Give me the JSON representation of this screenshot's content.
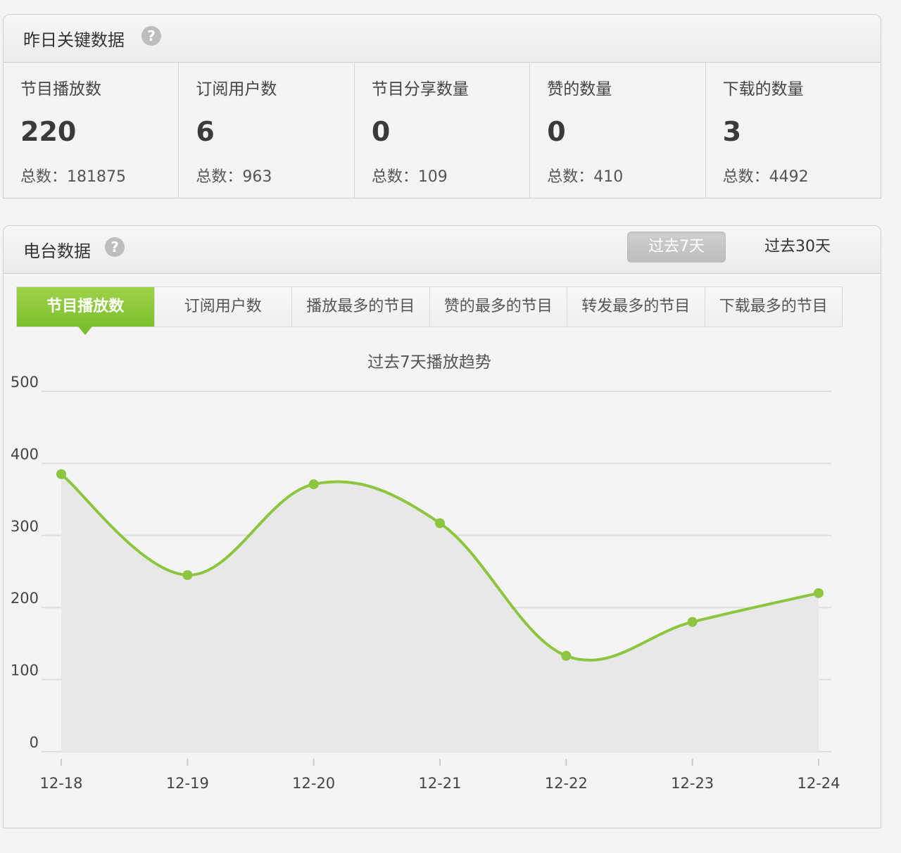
{
  "key_panel": {
    "title": "昨日关键数据",
    "help": "?",
    "stats": [
      {
        "label": "节目播放数",
        "value": "220",
        "total": "总数：181875"
      },
      {
        "label": "订阅用户数",
        "value": "6",
        "total": "总数：963"
      },
      {
        "label": "节目分享数量",
        "value": "0",
        "total": "总数：109"
      },
      {
        "label": "赞的数量",
        "value": "0",
        "total": "总数：410"
      },
      {
        "label": "下载的数量",
        "value": "3",
        "total": "总数：4492"
      }
    ]
  },
  "radio_panel": {
    "title": "电台数据",
    "help": "?",
    "range_active": "过去7天",
    "range_other": "过去30天",
    "tabs": [
      "节目播放数",
      "订阅用户数",
      "播放最多的节目",
      "赞的最多的节目",
      "转发最多的节目",
      "下载最多的节目"
    ]
  },
  "colors": {
    "accent": "#8cc63f",
    "area": "#e8e8e8"
  },
  "chart_data": {
    "type": "area",
    "title": "过去7天播放趋势",
    "categories": [
      "12-18",
      "12-19",
      "12-20",
      "12-21",
      "12-22",
      "12-23",
      "12-24"
    ],
    "values": [
      385,
      245,
      371,
      317,
      133,
      180,
      220
    ],
    "ylim": [
      0,
      500
    ],
    "yticks": [
      "0",
      "100",
      "200",
      "300",
      "400",
      "500"
    ],
    "grid": true
  }
}
